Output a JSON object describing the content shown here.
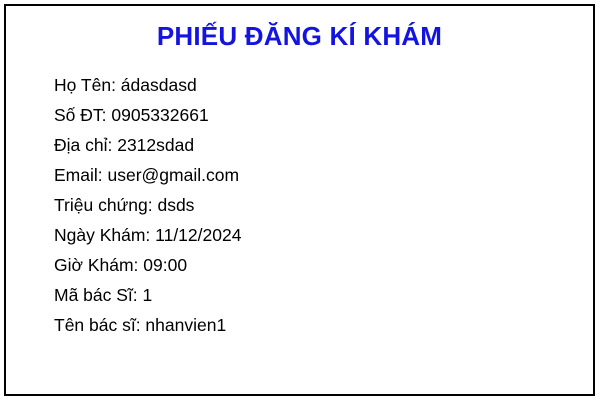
{
  "form": {
    "title": "PHIẾU ĐĂNG KÍ KHÁM",
    "fields": [
      {
        "label": "Họ Tên",
        "value": "ádasdasd",
        "text": "Họ Tên: ádasdasd"
      },
      {
        "label": "Số ĐT",
        "value": "0905332661",
        "text": "Số ĐT: 0905332661"
      },
      {
        "label": "Địa chỉ",
        "value": "2312sdad",
        "text": "Địa chỉ: 2312sdad"
      },
      {
        "label": "Email",
        "value": "user@gmail.com",
        "text": "Email: user@gmail.com"
      },
      {
        "label": "Triệu chứng",
        "value": "dsds",
        "text": "Triệu chứng: dsds"
      },
      {
        "label": "Ngày Khám",
        "value": "11/12/2024",
        "text": "Ngày Khám: 11/12/2024"
      },
      {
        "label": "Giờ Khám",
        "value": "09:00",
        "text": "Giờ Khám: 09:00"
      },
      {
        "label": "Mã bác Sĩ",
        "value": "1",
        "text": "Mã bác Sĩ: 1"
      },
      {
        "label": "Tên bác sĩ",
        "value": "nhanvien1",
        "text": "Tên bác sĩ: nhanvien1"
      }
    ]
  },
  "colors": {
    "title": "#1414e0",
    "border": "#000000",
    "text": "#000000",
    "background": "#ffffff"
  }
}
